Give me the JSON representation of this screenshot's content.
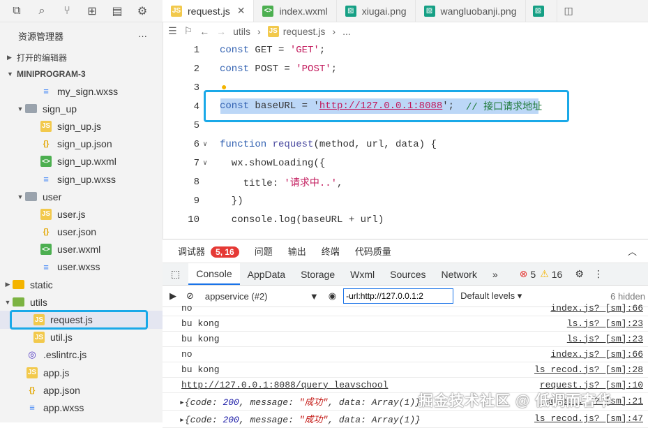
{
  "sidebar": {
    "explorer_title": "资源管理器",
    "more": "···",
    "section_open_editors": "打开的编辑器",
    "section_project": "MINIPROGRAM-3",
    "items": [
      {
        "label": "my_sign.wxss",
        "type": "wxss"
      },
      {
        "label": "sign_up",
        "type": "folder"
      },
      {
        "label": "sign_up.js",
        "type": "js"
      },
      {
        "label": "sign_up.json",
        "type": "json"
      },
      {
        "label": "sign_up.wxml",
        "type": "wxml"
      },
      {
        "label": "sign_up.wxss",
        "type": "wxss"
      },
      {
        "label": "user",
        "type": "folder"
      },
      {
        "label": "user.js",
        "type": "js"
      },
      {
        "label": "user.json",
        "type": "json"
      },
      {
        "label": "user.wxml",
        "type": "wxml"
      },
      {
        "label": "user.wxss",
        "type": "wxss"
      },
      {
        "label": "static",
        "type": "folder"
      },
      {
        "label": "utils",
        "type": "folder"
      },
      {
        "label": "request.js",
        "type": "js"
      },
      {
        "label": "util.js",
        "type": "js"
      },
      {
        "label": ".eslintrc.js",
        "type": "eslint"
      },
      {
        "label": "app.js",
        "type": "js"
      },
      {
        "label": "app.json",
        "type": "json"
      },
      {
        "label": "app.wxss",
        "type": "wxss"
      }
    ]
  },
  "tabs": [
    {
      "label": "request.js",
      "active": true
    },
    {
      "label": "index.wxml",
      "active": false
    },
    {
      "label": "xiugai.png",
      "active": false
    },
    {
      "label": "wangluobanji.png",
      "active": false
    }
  ],
  "breadcrumb": {
    "part1": "utils",
    "part2": "request.js",
    "part3": "..."
  },
  "editor": {
    "line_numbers": [
      "1",
      "2",
      "3",
      "4",
      "5",
      "6",
      "7",
      "8",
      "9",
      "10"
    ],
    "l1_kw": "const",
    "l1_rest": " GET = ",
    "l1_str": "'GET'",
    "l1_end": ";",
    "l2_kw": "const",
    "l2_rest": " POST = ",
    "l2_str": "'POST'",
    "l2_end": ";",
    "l4_kw": "const",
    "l4_rest": " baseURL = '",
    "l4_url": "http://127.0.0.1:8088",
    "l4_end": "';  ",
    "l4_comment": "// 接口请求地址",
    "l6_kw": "function",
    "l6_fn": " request",
    "l6_rest": "(method, url, data) {",
    "l7": "  wx.showLoading({",
    "l8_a": "    title: ",
    "l8_str": "'请求中..'",
    "l8_b": ",",
    "l9": "  })",
    "l10": "  console.log(baseURL + url)"
  },
  "devtools": {
    "panel_title": "调试器",
    "badge": "5, 16",
    "tab_issues": "问题",
    "tab_output": "输出",
    "tab_terminal": "终端",
    "tab_quality": "代码质量",
    "tabs": [
      "Console",
      "AppData",
      "Storage",
      "Wxml",
      "Sources",
      "Network"
    ],
    "more": "»",
    "errors": "5",
    "warnings": "16",
    "context": "appservice (#2)",
    "filter_value": "-url:http://127.0.0.1:2",
    "levels": "Default levels ▾",
    "hidden": "6 hidden",
    "logs": [
      {
        "msg": "no",
        "src": "index.js? [sm]:66"
      },
      {
        "msg": "bu kong",
        "src": "ls.js? [sm]:23"
      },
      {
        "msg": "bu kong",
        "src": "ls.js? [sm]:23"
      },
      {
        "msg": "no",
        "src": "index.js? [sm]:66"
      },
      {
        "msg": "bu kong",
        "src": "ls_recod.js? [sm]:28"
      },
      {
        "msg": "http://127.0.0.1:8088/query_leavschool",
        "src": "request.js? [sm]:10"
      }
    ],
    "obj_code_key": "code: ",
    "obj_code_val": "200",
    "obj_msg_key": ", message: ",
    "obj_msg_val": "\"成功\"",
    "obj_data": ", data: Array(1)}",
    "obj_src1": "request.js? [sm]:21",
    "obj_src2": "ls_recod.js? [sm]:47"
  },
  "watermark": "掘金技术社区 @ 低调而奢华"
}
